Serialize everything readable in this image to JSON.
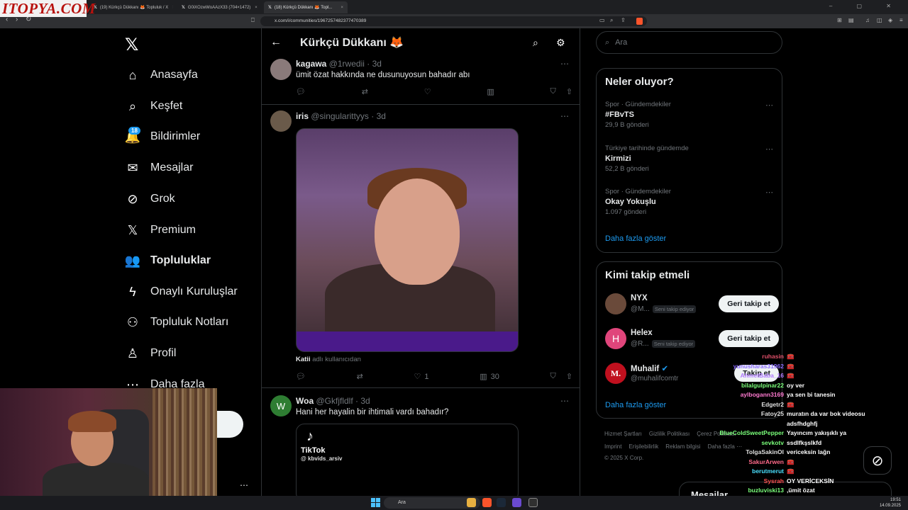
{
  "browser": {
    "watermark": "ITOPYA.COM",
    "tabs": [
      {
        "label": "(19) Kürkçü Dükkanı 🦊 Topluluk / X"
      },
      {
        "label": "G0iXOzwWoAAzX33 (704×1472)"
      },
      {
        "label": "(18) Kürkçü Dükkanı 🦊 Topl..."
      }
    ],
    "url": "x.com/i/communities/1967257482377470389"
  },
  "nav": {
    "items": [
      {
        "label": "Anasayfa",
        "icon": "home-icon",
        "glyph": "⌂"
      },
      {
        "label": "Keşfet",
        "icon": "search-icon",
        "glyph": "⌕"
      },
      {
        "label": "Bildirimler",
        "icon": "bell-icon",
        "glyph": "🔔"
      },
      {
        "label": "Mesajlar",
        "icon": "mail-icon",
        "glyph": "✉"
      },
      {
        "label": "Grok",
        "icon": "grok-icon",
        "glyph": "⊘"
      },
      {
        "label": "Premium",
        "icon": "x-premium-icon",
        "glyph": "𝕏"
      },
      {
        "label": "Topluluklar",
        "icon": "communities-icon",
        "glyph": "👥"
      },
      {
        "label": "Onaylı Kuruluşlar",
        "icon": "lightning-icon",
        "glyph": "ϟ"
      },
      {
        "label": "Topluluk Notları",
        "icon": "notes-icon",
        "glyph": "⚇"
      },
      {
        "label": "Profil",
        "icon": "profile-icon",
        "glyph": "♙"
      },
      {
        "label": "Daha fazla",
        "icon": "more-icon",
        "glyph": "⋯"
      }
    ],
    "notif_badge": "18"
  },
  "community": {
    "title": "Kürkçü Dükkanı 🦊"
  },
  "posts": [
    {
      "name": "kagawa",
      "handle": "@1rwedii",
      "time": "· 3d",
      "text": "ümit özat hakkında ne dusunuyosun bahadır abı"
    },
    {
      "name": "iris",
      "handle": "@singularittyys",
      "time": "· 3d",
      "credit_user": "Katii",
      "credit_suffix": "adlı kullanıcıdan",
      "likes": "1",
      "views": "30"
    },
    {
      "name": "Woa",
      "handle": "@Gkfjfldlf",
      "time": "· 3d",
      "avatar_letter": "W",
      "text": "Hani her hayalin bir ihtimali vardı bahadır?",
      "card_brand": "TikTok",
      "card_handle": "@ kbvids_arsiv"
    }
  ],
  "search": {
    "placeholder": "Ara"
  },
  "trends": {
    "title": "Neler oluyor?",
    "items": [
      {
        "category": "Spor · Gündemdekiler",
        "name": "#FBvTS",
        "count": "29,9 B gönderi"
      },
      {
        "category": "Türkiye tarihinde gündemde",
        "name": "Kirmizi",
        "count": "52,2 B gönderi"
      },
      {
        "category": "Spor · Gündemdekiler",
        "name": "Okay Yokuşlu",
        "count": "1.097 gönderi"
      }
    ],
    "show_more": "Daha fazla göster"
  },
  "who_to_follow": {
    "title": "Kimi takip etmeli",
    "items": [
      {
        "name": "NYX",
        "handle": "@M...",
        "follows_you": "Seni takip ediyor",
        "button": "Geri takip et"
      },
      {
        "name": "Helex",
        "handle": "@R...",
        "follows_you": "Seni takip ediyor",
        "button": "Geri takip et",
        "avatar_letter": "H"
      },
      {
        "name": "Muhalif",
        "handle": "@muhalifcomtr",
        "button": "Takip et",
        "avatar_letter": "M."
      }
    ],
    "show_more": "Daha fazla göster"
  },
  "footer": {
    "links": [
      "Hizmet Şartları",
      "Gizlilik Politikası",
      "Çerez Politikası",
      "Imprint",
      "Erişilebilirlik",
      "Reklam bilgisi",
      "Daha fazla ⋯"
    ],
    "copyright": "© 2025 X Corp."
  },
  "messages_bar": "Mesajlar",
  "chat": [
    {
      "user": "ruhasin",
      "msg": "🧰",
      "color": "#e0506a"
    },
    {
      "user": "yunusharas31962",
      "msg": "🧰",
      "color": "#8a6aff"
    },
    {
      "user": "AhmetBaba_16",
      "msg": "🧰",
      "color": "#b07aff"
    },
    {
      "user": "bilalgulpinar22",
      "msg": "oy ver",
      "color": "#7aff7a"
    },
    {
      "user": "aylbogann3169",
      "msg": "ya sen bi tanesin",
      "color": "#ff7ad0"
    },
    {
      "user": "Edgetr2",
      "msg": "🧰",
      "color": "#e0e0e0"
    },
    {
      "user": "Fatoy25",
      "msg": "muratın da var bok videosu",
      "color": "#e0e0e0"
    },
    {
      "user": "",
      "msg": "adsfhdghfj",
      "color": "#e0e0e0"
    },
    {
      "user": "BlueColdSweetPepper",
      "msg": "Yayıncım yakışıklı ya",
      "color": "#7aff7a"
    },
    {
      "user": "sevkotv",
      "msg": "ssdlfkşslkfd",
      "color": "#7aff7a"
    },
    {
      "user": "TolgaSakinOl",
      "msg": "vericeksin lağn",
      "color": "#e0e0e0"
    },
    {
      "user": "SakurArwen",
      "msg": "🧰",
      "color": "#ff6a8a"
    },
    {
      "user": "berutmerut",
      "msg": "🧰",
      "color": "#4ae0ff"
    },
    {
      "user": "Sysrah",
      "msg": "OY VERİCEKSİN",
      "color": "#ff5050"
    },
    {
      "user": "buzluviski13",
      "msg": ",ümit özat",
      "color": "#7aff7a"
    }
  ],
  "taskbar": {
    "search_placeholder": "Ara",
    "time": "19:51",
    "date": "14.09.2025"
  }
}
